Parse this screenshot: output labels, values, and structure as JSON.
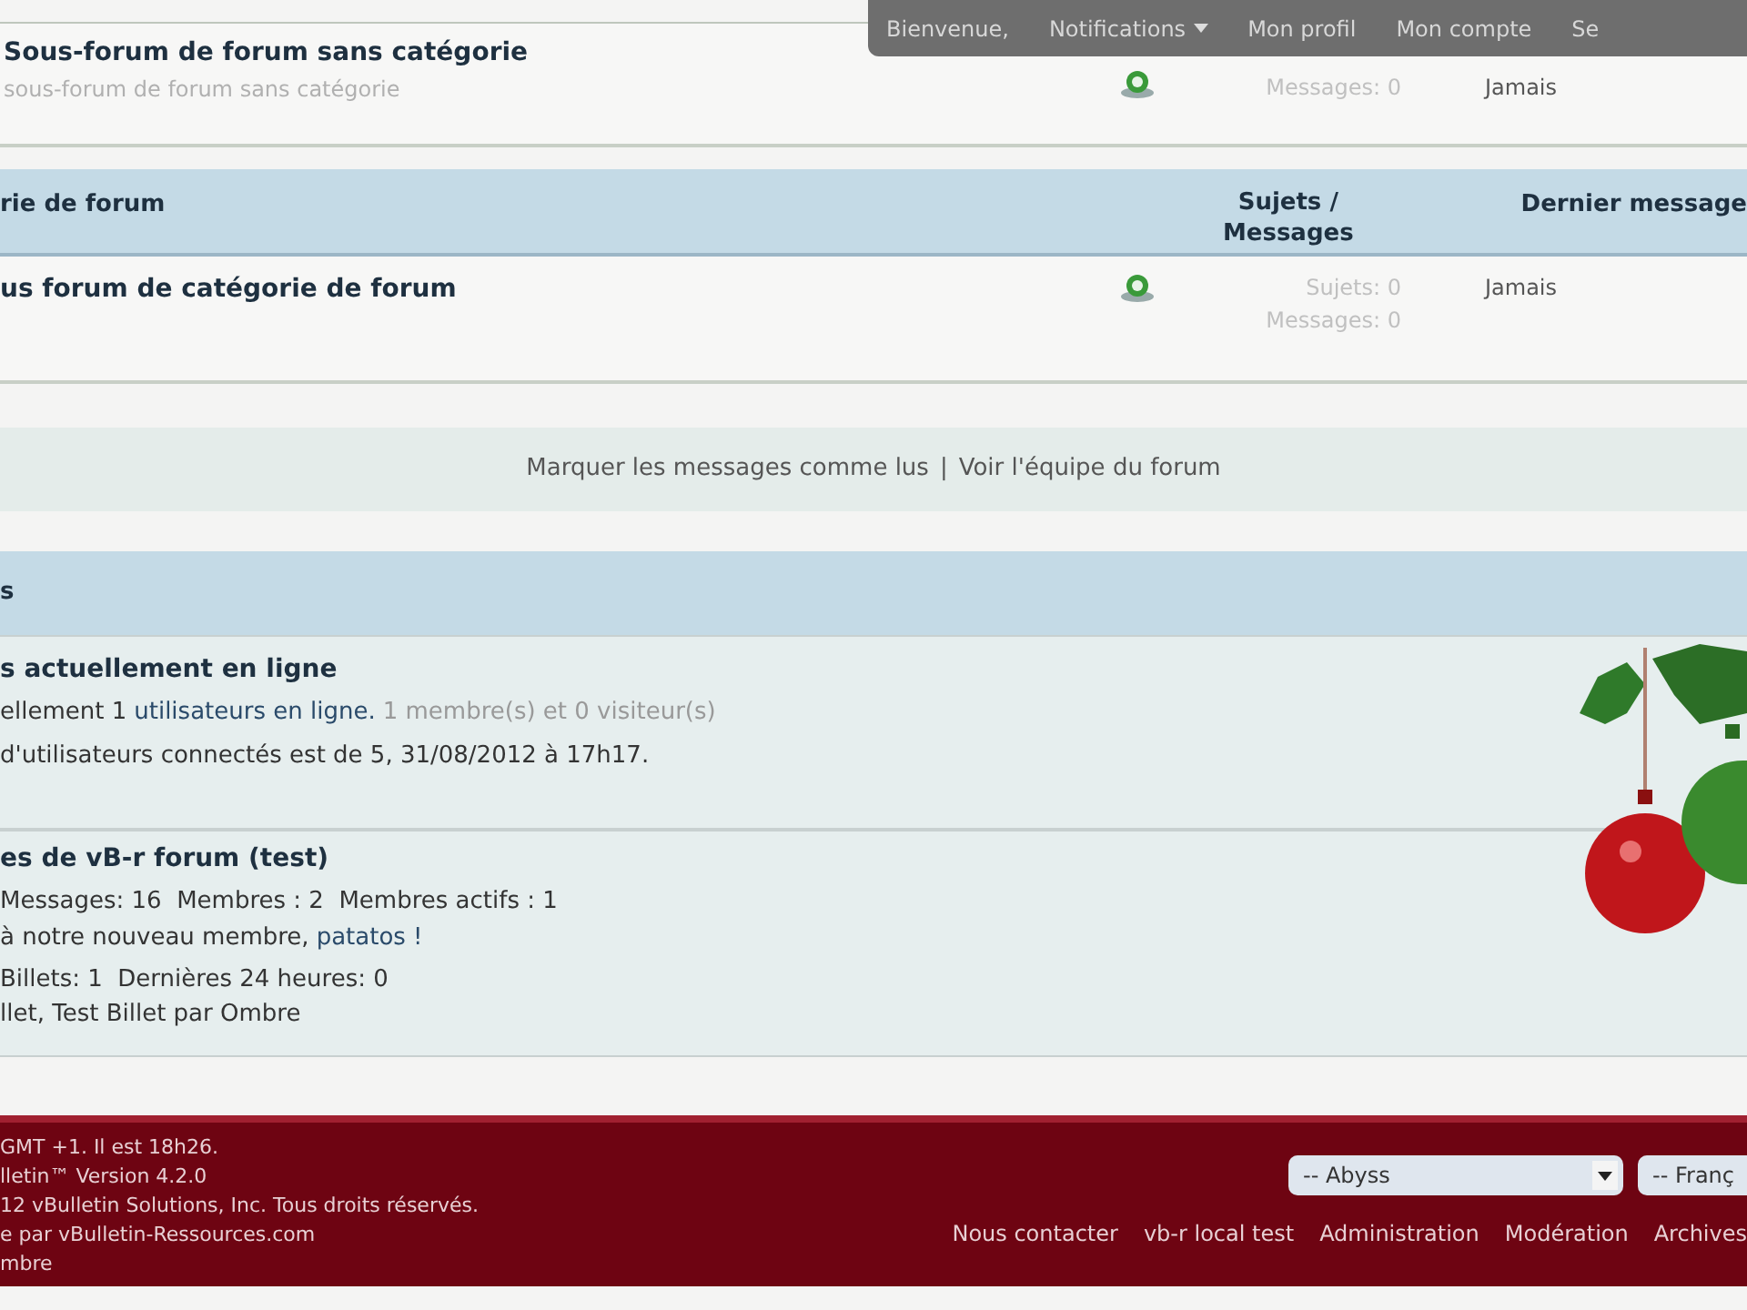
{
  "user_bar": {
    "items": [
      "Bienvenue,",
      "Notifications",
      "Mon profil",
      "Mon compte",
      "Se"
    ]
  },
  "forum_row_top": {
    "title": "Sous-forum de forum sans catégorie",
    "description": "sous-forum de forum sans catégorie",
    "stats": [
      "Messages: 0"
    ],
    "last_post": "Jamais"
  },
  "category": {
    "title": "rie de forum",
    "columns": [
      "Sujets / Messages",
      "Dernier message"
    ],
    "forums": [
      {
        "title": "us forum de catégorie de forum",
        "stats": [
          "Sujets: 0",
          "Messages: 0"
        ],
        "last_post": "Jamais"
      }
    ]
  },
  "links_bar": {
    "links": [
      "Marquer les messages comme lus",
      "Voir l'équipe du forum"
    ],
    "separator": "|"
  },
  "whats_going_on": {
    "title": "s",
    "online": {
      "heading": "s actuellement en ligne",
      "line_1_start": "ellement 1",
      "line_1_link": "utilisateurs en ligne.",
      "line_1_detail": "1 membre(s) et 0 visiteur(s)",
      "line_2": "d'utilisateurs connectés est de 5, 31/08/2012 à 17h17."
    },
    "stats": {
      "heading": "es de vB-r forum (test)",
      "counts": "Messages: 16  Membres : 2  Membres actifs : 1",
      "welcome_start": "à notre nouveau membre,",
      "welcome_link": "patatos !",
      "blog_counts": "Billets: 1  Dernières 24 heures: 0",
      "latest_blog": "llet, Test Billet par Ombre"
    }
  },
  "footer": {
    "lines": [
      "GMT +1. Il est 18h26.",
      "lletin™ Version 4.2.0",
      "12 vBulletin Solutions, Inc. Tous droits réservés.",
      "e par vBulletin-Ressources.com",
      "mbre"
    ],
    "selects": [
      {
        "value": "-- Abyss"
      },
      {
        "value": "-- Franç"
      }
    ],
    "links": [
      "Nous contacter",
      "vb-r local test",
      "Administration",
      "Modération",
      "Archives"
    ]
  }
}
